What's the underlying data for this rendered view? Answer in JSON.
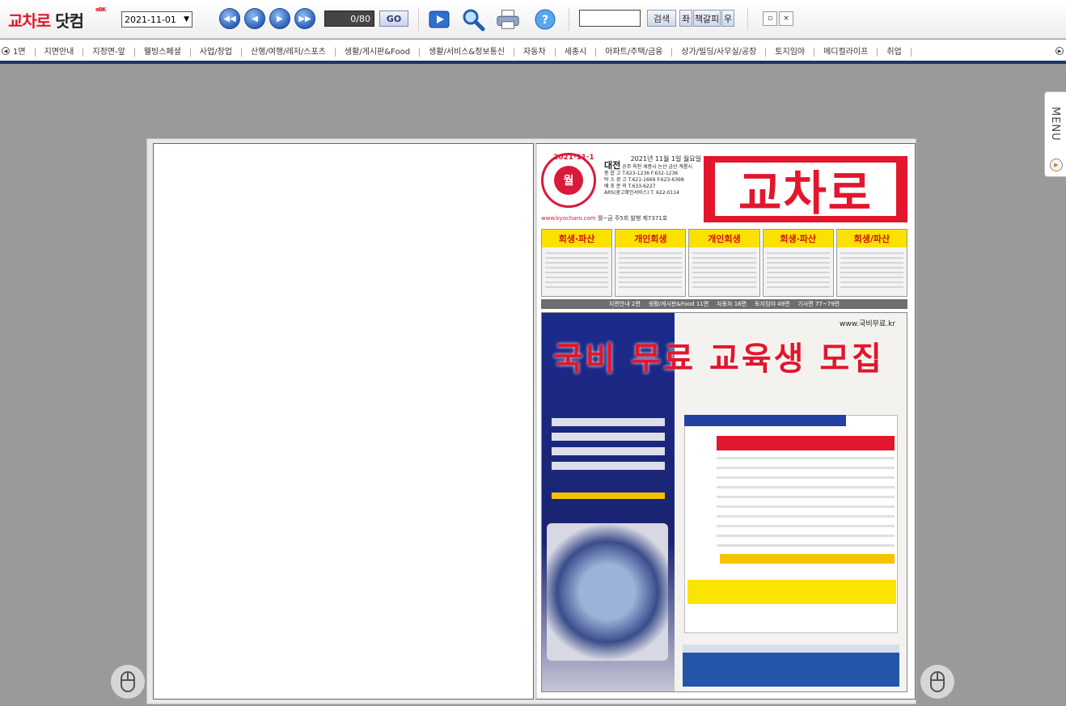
{
  "app": {
    "logo_text_red": "교차로",
    "logo_text_black": " 닷컴",
    "logo_superscript": "eBK"
  },
  "toolbar": {
    "date_value": "2021-11-01",
    "page_indicator": "0/80",
    "go_label": "GO",
    "search_button": "검색",
    "search_placeholder": "",
    "left_label": "좌",
    "spread_label": "책갈피",
    "right_label": "우",
    "restore_label": "▫",
    "close_label": "×"
  },
  "sections": [
    "1면",
    "지면안내",
    "지정면-앞",
    "웰빙스페셜",
    "사업/창업",
    "산행/여행/레저/스포츠",
    "생활/게시판&Food",
    "생활/서비스&정보통신",
    "자동차",
    "세종시",
    "아파트/주택/금융",
    "상가/빌딩/사무실/공장",
    "토지임야",
    "메디컬라이프",
    "취업"
  ],
  "side_menu": {
    "label": "MENU"
  },
  "newspaper": {
    "date_line": "2021년 11월 1일 월요일",
    "seal_text": "월",
    "seal_ring": "2021·11·1",
    "city": "대전",
    "cities": "공주 옥천 세종시 논산 금산 계룡시",
    "phone1": "종 합 고 T.623-1236 F.632-1236",
    "phone2": "탁 소 광 고 T.621-1669 F.623-6398",
    "phone3": "배 포 문 의 T.633-6227",
    "phone4": "ARS(광고확인서비스) T. 622-0114",
    "title": "교차로",
    "url": "www.kyocharo.com",
    "url_rest": " 월~금 주5회 발행 제7371호",
    "ads": [
      "회생·파산",
      "개인회생",
      "개인회생",
      "회생·파산",
      "회생/파산"
    ],
    "index": [
      "지면안내 2면",
      "생활/게시판&Food 11면",
      "자동차 16면",
      "토지임야 49면",
      "기사면 77~79면"
    ],
    "big_ad_headline": "국비 무료 교육생 모집",
    "big_ad_site": "www.국비무료.kr"
  }
}
